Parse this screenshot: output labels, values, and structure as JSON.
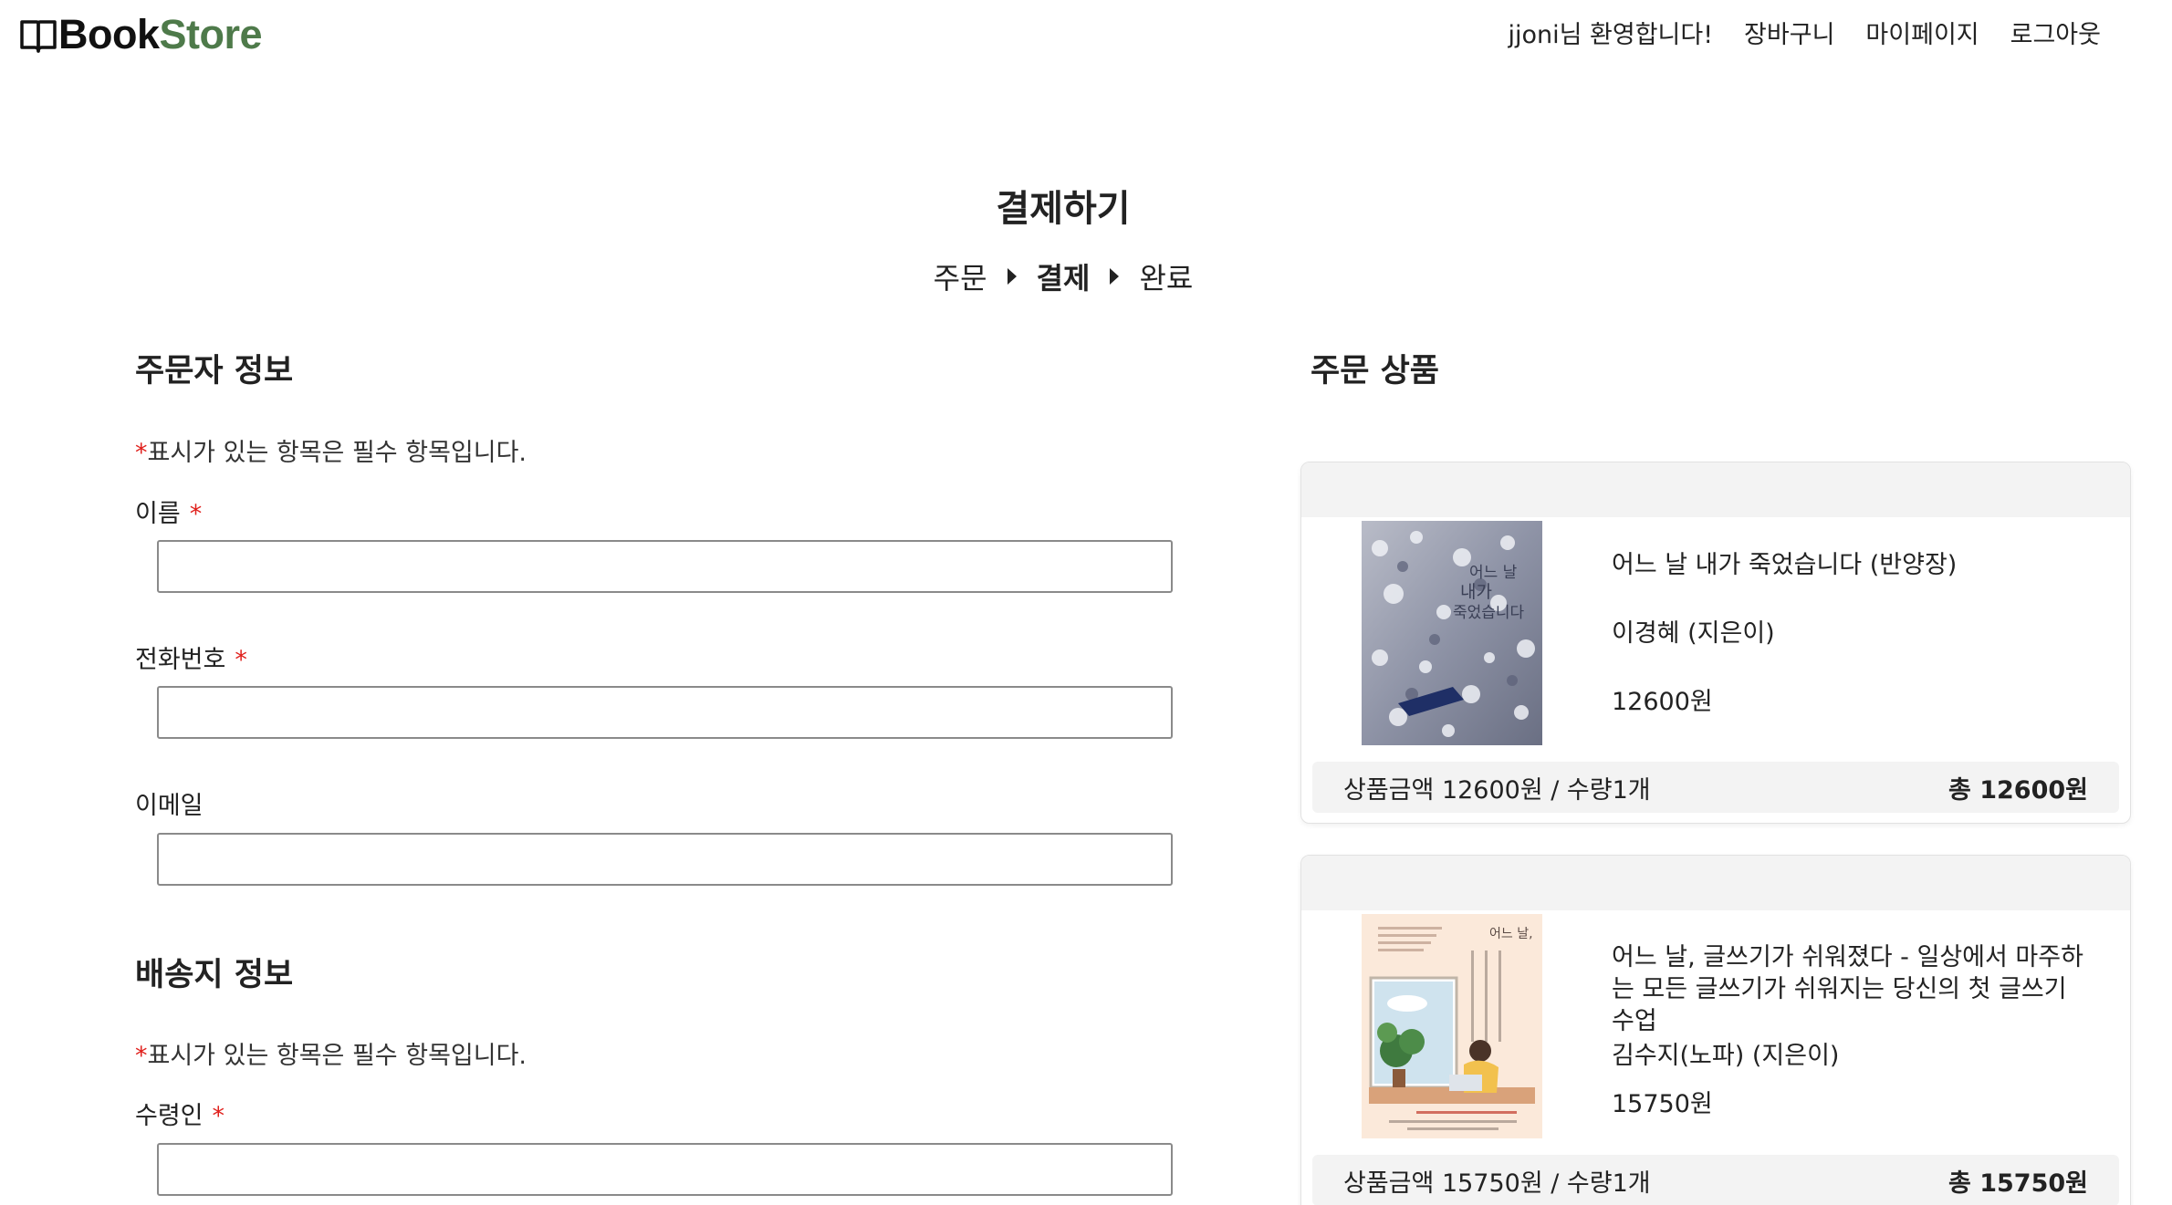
{
  "header": {
    "logo_book": "Book",
    "logo_store": "Store",
    "nav": {
      "welcome": "jjoni님 환영합니다!",
      "cart": "장바구니",
      "mypage": "마이페이지",
      "logout": "로그아웃"
    }
  },
  "page": {
    "title": "결제하기",
    "steps": [
      "주문",
      "결제",
      "완료"
    ],
    "active_step": "결제"
  },
  "orderer": {
    "section_title": "주문자 정보",
    "required_note": "표시가 있는 항목은 필수 항목입니다.",
    "required_mark": "*",
    "fields": [
      {
        "label": "이름",
        "required": true,
        "value": ""
      },
      {
        "label": "전화번호",
        "required": true,
        "value": ""
      },
      {
        "label": "이메일",
        "required": false,
        "value": ""
      }
    ]
  },
  "shipping": {
    "section_title": "배송지 정보",
    "required_note": "표시가 있는 항목은 필수 항목입니다.",
    "fields": [
      {
        "label": "수령인",
        "required": true,
        "value": ""
      }
    ]
  },
  "order_items": {
    "section_title": "주문 상품",
    "items": [
      {
        "title": "어느 날 내가 죽었습니다 (반양장)",
        "author": "이경혜 (지은이)",
        "price": "12600원",
        "summary": "상품금액 12600원 / 수량1개",
        "total": "총 12600원",
        "cover_text": "어느 날 내가 죽었습니다"
      },
      {
        "title": "어느 날, 글쓰기가 쉬워졌다 - 일상에서 마주하는 모든 글쓰기가 쉬워지는 당신의 첫 글쓰기 수업",
        "author": "김수지(노파) (지은이)",
        "price": "15750원",
        "summary": "상품금액 15750원 / 수량1개",
        "total": "총 15750원",
        "cover_text": "어느 날, 글쓰기가 쉬워졌다"
      }
    ]
  },
  "colors": {
    "brand_green": "#4e7a4a",
    "required_red": "#e0201c",
    "card_header_bg": "#f3f3f3"
  }
}
